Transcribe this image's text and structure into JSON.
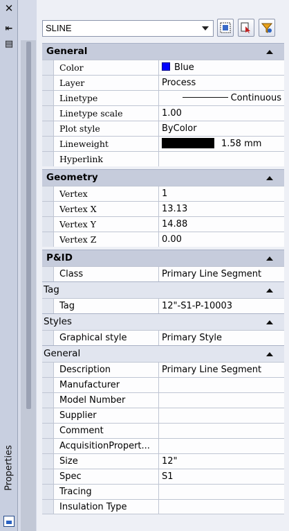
{
  "titlebar": {
    "close_glyph": "✕",
    "autohide_glyph": "⇤",
    "props_glyph": "▤",
    "title": "Properties"
  },
  "selector": {
    "value": "SLINE"
  },
  "sections": {
    "general": {
      "title": "General",
      "color": {
        "label": "Color",
        "value": "Blue",
        "swatch": "#0000ff"
      },
      "layer": {
        "label": "Layer",
        "value": "Process"
      },
      "linetype": {
        "label": "Linetype",
        "value": "Continuous"
      },
      "linetype_scale": {
        "label": "Linetype scale",
        "value": "1.00"
      },
      "plot_style": {
        "label": "Plot style",
        "value": "ByColor"
      },
      "lineweight": {
        "label": "Lineweight",
        "value": "1.58 mm"
      },
      "hyperlink": {
        "label": "Hyperlink",
        "value": ""
      }
    },
    "geometry": {
      "title": "Geometry",
      "vertex": {
        "label": "Vertex",
        "value": "1"
      },
      "vertex_x": {
        "label": "Vertex X",
        "value": "13.13"
      },
      "vertex_y": {
        "label": "Vertex Y",
        "value": "14.88"
      },
      "vertex_z": {
        "label": "Vertex Z",
        "value": "0.00"
      }
    },
    "pid": {
      "title": "P&ID",
      "class": {
        "label": "Class",
        "value": "Primary Line Segment"
      }
    },
    "tag": {
      "title": "Tag",
      "tag": {
        "label": "Tag",
        "value": "12\"-S1-P-10003"
      }
    },
    "styles": {
      "title": "Styles",
      "graphical_style": {
        "label": "Graphical style",
        "value": "Primary Style"
      }
    },
    "general2": {
      "title": "General",
      "description": {
        "label": "Description",
        "value": "Primary Line Segment"
      },
      "manufacturer": {
        "label": "Manufacturer",
        "value": ""
      },
      "model_number": {
        "label": "Model Number",
        "value": ""
      },
      "supplier": {
        "label": "Supplier",
        "value": ""
      },
      "comment": {
        "label": "Comment",
        "value": ""
      },
      "acquisition": {
        "label": "AcquisitionPropert...",
        "value": ""
      },
      "size": {
        "label": "Size",
        "value": "12\""
      },
      "spec": {
        "label": "Spec",
        "value": "S1"
      },
      "tracing": {
        "label": "Tracing",
        "value": ""
      },
      "insulation": {
        "label": "Insulation Type",
        "value": ""
      }
    }
  }
}
